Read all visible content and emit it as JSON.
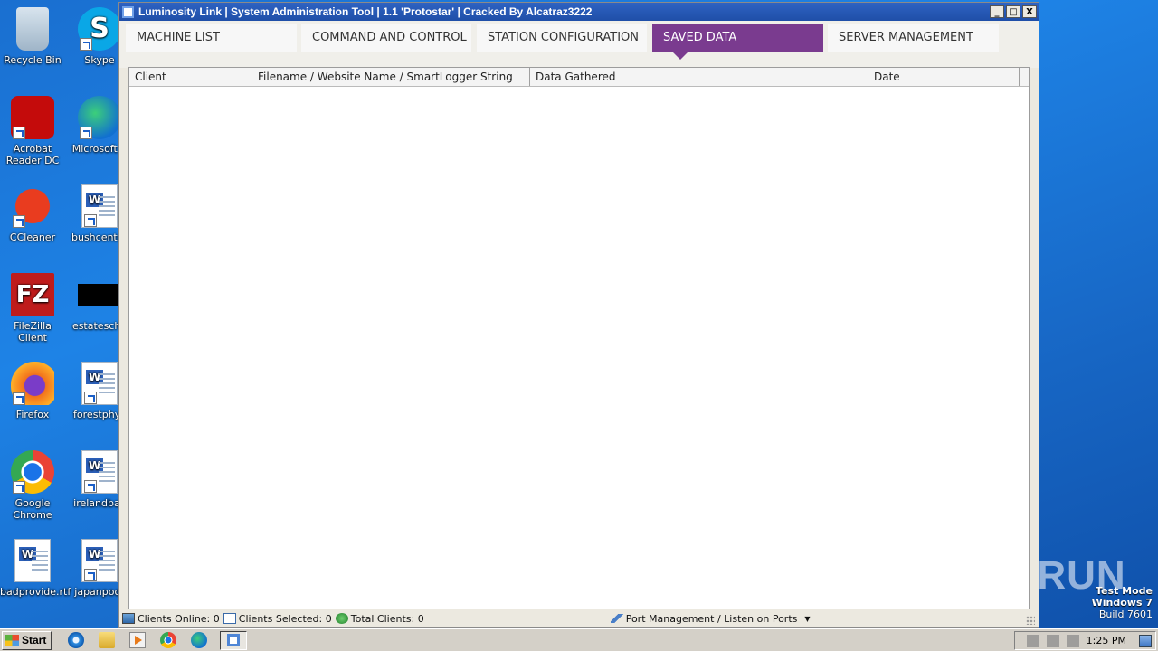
{
  "desktop": {
    "icons": [
      {
        "label": "Recycle Bin",
        "icon": "recycle-bin-icon"
      },
      {
        "label": "Skype",
        "icon": "skype-icon"
      },
      {
        "label": "Acrobat Reader DC",
        "icon": "acrobat-icon"
      },
      {
        "label": "Microsoft E",
        "icon": "edge-icon"
      },
      {
        "label": "CCleaner",
        "icon": "ccleaner-icon"
      },
      {
        "label": "bushcentra",
        "icon": "word-doc-icon"
      },
      {
        "label": "FileZilla Client",
        "icon": "filezilla-icon"
      },
      {
        "label": "estatescho",
        "icon": "black-file-icon"
      },
      {
        "label": "Firefox",
        "icon": "firefox-icon"
      },
      {
        "label": "forestphys",
        "icon": "word-doc-icon"
      },
      {
        "label": "Google Chrome",
        "icon": "chrome-icon"
      },
      {
        "label": "irelandball",
        "icon": "word-doc-icon"
      },
      {
        "label": "badprovide.rtf",
        "icon": "word-doc-icon"
      },
      {
        "label": "japanpoor",
        "icon": "word-doc-icon"
      }
    ]
  },
  "window": {
    "title": "Luminosity Link | System Administration Tool | 1.1 'Protostar' | Cracked By Alcatraz3222",
    "controls": {
      "minimize": "_",
      "maximize": "□",
      "close": "X"
    },
    "tabs": [
      {
        "label": "MACHINE LIST"
      },
      {
        "label": "COMMAND AND CONTROL"
      },
      {
        "label": "STATION CONFIGURATION"
      },
      {
        "label": "SAVED DATA"
      },
      {
        "label": "SERVER MANAGEMENT"
      }
    ],
    "active_tab": "SAVED DATA",
    "table": {
      "columns": [
        "Client",
        "Filename / Website Name / SmartLogger String",
        "Data Gathered",
        "Date"
      ],
      "rows": []
    },
    "status": {
      "clients_online": "Clients Online: 0",
      "clients_selected": "Clients Selected: 0",
      "total_clients": "Total Clients: 0",
      "port_management": "Port Management / Listen on Ports"
    }
  },
  "taskbar": {
    "start_label": "Start",
    "clock": "1:25 PM"
  },
  "overlay": {
    "watermark": "ANY RUN",
    "test_mode": "Test Mode",
    "os": "Windows 7",
    "build": "Build 7601"
  },
  "colors": {
    "active_tab": "#7a3b8f",
    "title_bar": "#2e63c2",
    "desktop": "#1e83e6"
  }
}
